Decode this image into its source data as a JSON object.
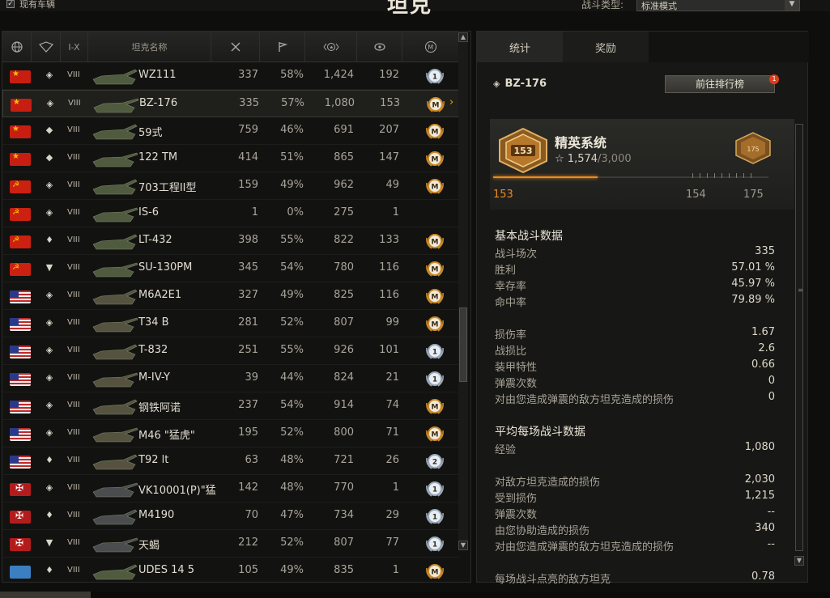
{
  "topbar": {
    "checkbox_label": "现有车辆",
    "title": "坦克",
    "battle_type_label": "战斗类型:",
    "battle_type_value": "标准模式"
  },
  "table": {
    "headers": {
      "name": "坦克名称",
      "tier": "I-X"
    },
    "rows": [
      {
        "nation": "cn",
        "type": "heavy",
        "tier": "VIII",
        "name": "WZ111",
        "battles": "337",
        "winrate": "58%",
        "xp": "1,424",
        "damage": "192",
        "mark": "1",
        "mark_kind": "silver"
      },
      {
        "nation": "cn",
        "type": "heavy",
        "tier": "VIII",
        "name": "BZ-176",
        "battles": "335",
        "winrate": "57%",
        "xp": "1,080",
        "damage": "153",
        "mark": "M",
        "mark_kind": "gold",
        "selected": true
      },
      {
        "nation": "cn",
        "type": "medium",
        "tier": "VIII",
        "name": "59式",
        "battles": "759",
        "winrate": "46%",
        "xp": "691",
        "damage": "207",
        "mark": "M",
        "mark_kind": "gold"
      },
      {
        "nation": "cn",
        "type": "medium",
        "tier": "VIII",
        "name": "122 TM",
        "battles": "414",
        "winrate": "51%",
        "xp": "865",
        "damage": "147",
        "mark": "M",
        "mark_kind": "gold"
      },
      {
        "nation": "su",
        "type": "heavy",
        "tier": "VIII",
        "name": "703工程II型",
        "battles": "159",
        "winrate": "49%",
        "xp": "962",
        "damage": "49",
        "mark": "M",
        "mark_kind": "gold"
      },
      {
        "nation": "su",
        "type": "heavy",
        "tier": "VIII",
        "name": "IS-6",
        "battles": "1",
        "winrate": "0%",
        "xp": "275",
        "damage": "1",
        "mark": "",
        "mark_kind": ""
      },
      {
        "nation": "su",
        "type": "light",
        "tier": "VIII",
        "name": "LT-432",
        "battles": "398",
        "winrate": "55%",
        "xp": "822",
        "damage": "133",
        "mark": "M",
        "mark_kind": "gold"
      },
      {
        "nation": "su",
        "type": "td",
        "tier": "VIII",
        "name": "SU-130PM",
        "battles": "345",
        "winrate": "54%",
        "xp": "780",
        "damage": "116",
        "mark": "M",
        "mark_kind": "gold"
      },
      {
        "nation": "us",
        "type": "heavy",
        "tier": "VIII",
        "name": "M6A2E1",
        "battles": "327",
        "winrate": "49%",
        "xp": "825",
        "damage": "116",
        "mark": "M",
        "mark_kind": "gold"
      },
      {
        "nation": "us",
        "type": "heavy",
        "tier": "VIII",
        "name": "T34 B",
        "battles": "281",
        "winrate": "52%",
        "xp": "807",
        "damage": "99",
        "mark": "M",
        "mark_kind": "gold"
      },
      {
        "nation": "us",
        "type": "heavy",
        "tier": "VIII",
        "name": "T-832",
        "battles": "251",
        "winrate": "55%",
        "xp": "926",
        "damage": "101",
        "mark": "1",
        "mark_kind": "silver"
      },
      {
        "nation": "us",
        "type": "heavy",
        "tier": "VIII",
        "name": "M-IV-Y",
        "battles": "39",
        "winrate": "44%",
        "xp": "824",
        "damage": "21",
        "mark": "1",
        "mark_kind": "silver"
      },
      {
        "nation": "us",
        "type": "heavy",
        "tier": "VIII",
        "name": "钢铁阿诺",
        "battles": "237",
        "winrate": "54%",
        "xp": "914",
        "damage": "74",
        "mark": "M",
        "mark_kind": "gold"
      },
      {
        "nation": "us",
        "type": "heavy",
        "tier": "VIII",
        "name": "M46 \"猛虎\"",
        "battles": "195",
        "winrate": "52%",
        "xp": "800",
        "damage": "71",
        "mark": "M",
        "mark_kind": "gold"
      },
      {
        "nation": "us",
        "type": "light",
        "tier": "VIII",
        "name": "T92 lt",
        "battles": "63",
        "winrate": "48%",
        "xp": "721",
        "damage": "26",
        "mark": "2",
        "mark_kind": "silver2"
      },
      {
        "nation": "de",
        "type": "heavy",
        "tier": "VIII",
        "name": "VK10001(P)\"猛",
        "battles": "142",
        "winrate": "48%",
        "xp": "770",
        "damage": "1",
        "mark": "1",
        "mark_kind": "silver"
      },
      {
        "nation": "de",
        "type": "light",
        "tier": "VIII",
        "name": "M4190",
        "battles": "70",
        "winrate": "47%",
        "xp": "734",
        "damage": "29",
        "mark": "1",
        "mark_kind": "silver"
      },
      {
        "nation": "de",
        "type": "td",
        "tier": "VIII",
        "name": "天蝎",
        "battles": "212",
        "winrate": "52%",
        "xp": "807",
        "damage": "77",
        "mark": "1",
        "mark_kind": "silver"
      },
      {
        "nation": "uk",
        "type": "light",
        "tier": "VIII",
        "name": "UDES 14 5",
        "battles": "105",
        "winrate": "49%",
        "xp": "835",
        "damage": "1",
        "mark": "M",
        "mark_kind": "gold"
      }
    ]
  },
  "right": {
    "tabs": [
      "统计",
      "奖励"
    ],
    "selected_tank": "BZ-176",
    "ranking_button": "前往排行榜",
    "ranking_badge": "1",
    "elite": {
      "title": "精英系统",
      "xp_current": "1,574",
      "xp_max": "/3,000",
      "level_current": "153",
      "level_next_badge": "175",
      "progress": 0.38,
      "labels": [
        "153",
        "154",
        "175"
      ]
    },
    "sections": [
      {
        "title": "基本战斗数据",
        "rows": [
          {
            "label": "战斗场次",
            "value": "335"
          },
          {
            "label": "胜利",
            "value": "57.01 %"
          },
          {
            "label": "幸存率",
            "value": "45.97 %"
          },
          {
            "label": "命中率",
            "value": "79.89 %"
          }
        ]
      },
      {
        "title": "",
        "rows": [
          {
            "label": "损伤率",
            "value": "1.67"
          },
          {
            "label": "战损比",
            "value": "2.6"
          },
          {
            "label": "装甲特性",
            "value": "0.66"
          },
          {
            "label": "弹震次数",
            "value": "0"
          },
          {
            "label": "对由您造成弹震的敌方坦克造成的损伤",
            "value": "0"
          }
        ]
      },
      {
        "title": "平均每场战斗数据",
        "rows": [
          {
            "label": "经验",
            "value": "1,080"
          }
        ]
      },
      {
        "title": "",
        "rows": [
          {
            "label": "对敌方坦克造成的损伤",
            "value": "2,030"
          },
          {
            "label": "受到损伤",
            "value": "1,215"
          },
          {
            "label": "弹震次数",
            "value": "--"
          },
          {
            "label": "由您协助造成的损伤",
            "value": "340"
          },
          {
            "label": "对由您造成弹震的敌方坦克造成的损伤",
            "value": "--"
          }
        ]
      },
      {
        "title": "",
        "rows": [
          {
            "label": "每场战斗点亮的敌方坦克",
            "value": "0.78"
          }
        ]
      }
    ]
  },
  "colors": {
    "accent": "#f08a1c",
    "gold": "#c9892a",
    "silver": "#9aa6b4"
  }
}
